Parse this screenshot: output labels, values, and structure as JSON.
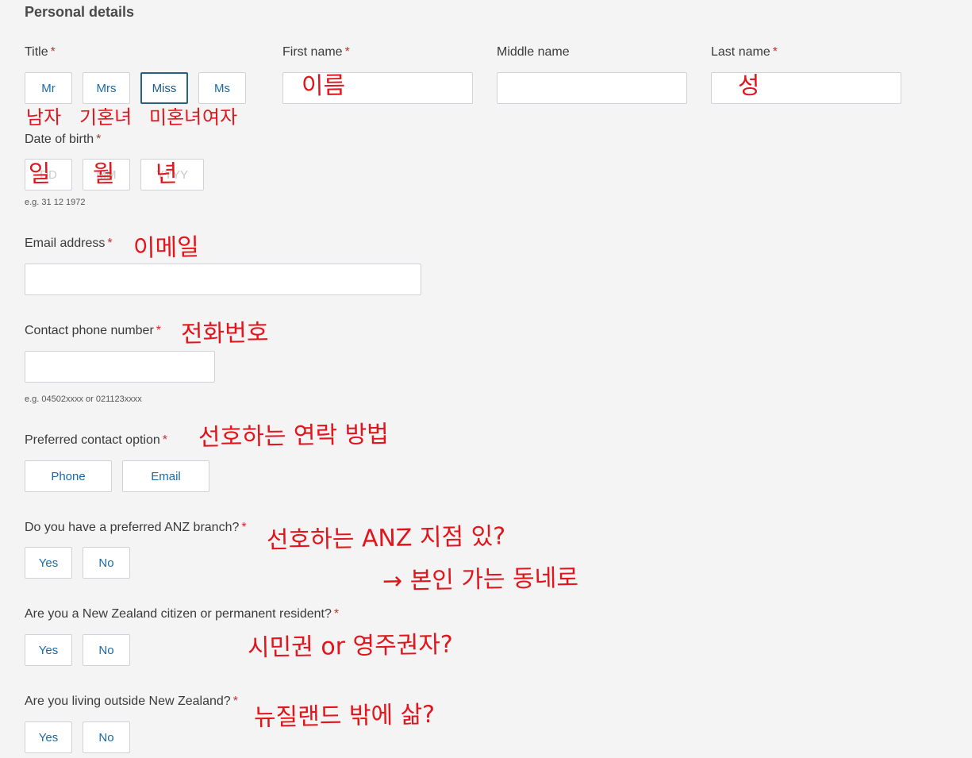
{
  "section_title": "Personal details",
  "required_mark": "*",
  "title_field": {
    "label": "Title",
    "options": [
      "Mr",
      "Mrs",
      "Miss",
      "Ms"
    ],
    "selected": "Miss"
  },
  "first_name": {
    "label": "First name",
    "value": ""
  },
  "middle_name": {
    "label": "Middle name",
    "value": ""
  },
  "last_name": {
    "label": "Last name",
    "value": ""
  },
  "date_of_birth": {
    "label": "Date of birth",
    "day_placeholder": "DD",
    "month_placeholder": "MM",
    "year_placeholder": "YYYY",
    "hint": "e.g. 31 12 1972"
  },
  "email": {
    "label": "Email address",
    "value": ""
  },
  "phone": {
    "label": "Contact phone number",
    "value": "",
    "hint": "e.g. 04502xxxx or 021123xxxx"
  },
  "preferred_contact": {
    "label": "Preferred contact option",
    "options": [
      "Phone",
      "Email"
    ]
  },
  "preferred_branch": {
    "label": "Do you have a preferred ANZ branch?",
    "options": [
      "Yes",
      "No"
    ]
  },
  "nz_citizen": {
    "label": "Are you a New Zealand citizen or permanent resident?",
    "options": [
      "Yes",
      "No"
    ]
  },
  "living_outside": {
    "label": "Are you living outside New Zealand?",
    "options": [
      "Yes",
      "No"
    ]
  },
  "annotations": {
    "first_name": "이름",
    "last_name": "성",
    "title_mr": "남자",
    "title_mrs": "기혼녀",
    "title_miss": "미혼녀",
    "title_ms": "여자",
    "dob_day": "일",
    "dob_month": "월",
    "dob_year": "년",
    "email": "이메일",
    "phone": "전화번호",
    "preferred_contact": "선호하는 연락 방법",
    "branch_question": "선호하는 ANZ 지점 있?",
    "branch_answer": "→ 본인 가는 동네로",
    "citizen": "시민권 or 영주권자?",
    "outside": "뉴질랜드 밖에 삶?"
  },
  "colors": {
    "background": "#f4f4f5",
    "button_text": "#1a6aa8",
    "selected_border": "#27627e",
    "required_mark": "#d22a2a",
    "annotation": "#e3141b"
  }
}
